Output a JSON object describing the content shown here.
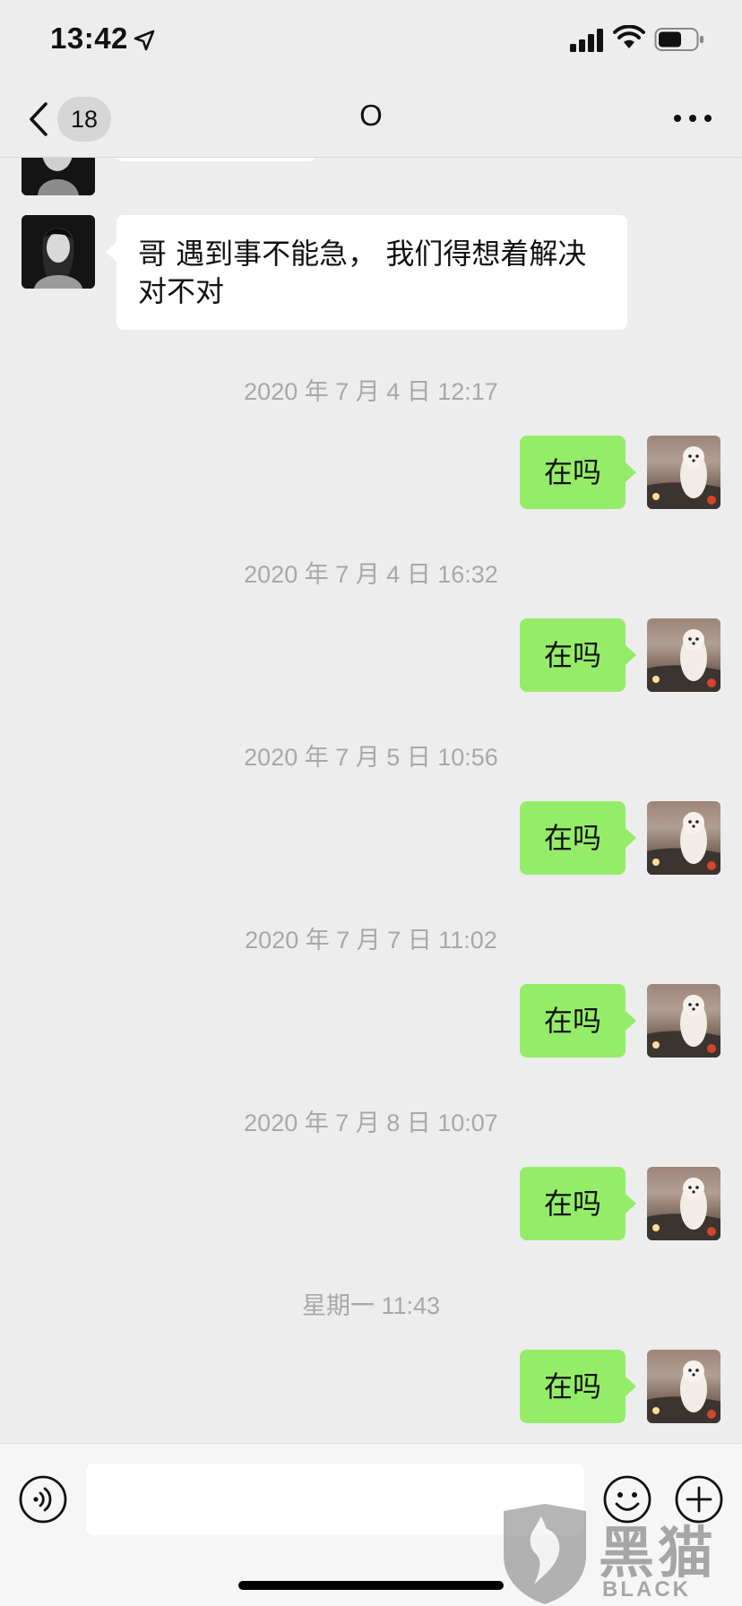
{
  "status_bar": {
    "time": "13:42"
  },
  "nav": {
    "unread_count": "18",
    "title": "O"
  },
  "messages": [
    {
      "type": "in",
      "text": "哥   遇到事不能急， 我们得想着解决对不对"
    },
    {
      "type": "time",
      "text": "2020 年 7 月 4 日 12:17"
    },
    {
      "type": "out",
      "text": "在吗"
    },
    {
      "type": "time",
      "text": "2020 年 7 月 4 日 16:32"
    },
    {
      "type": "out",
      "text": "在吗"
    },
    {
      "type": "time",
      "text": "2020 年 7 月 5 日 10:56"
    },
    {
      "type": "out",
      "text": "在吗"
    },
    {
      "type": "time",
      "text": "2020 年 7 月 7 日 11:02"
    },
    {
      "type": "out",
      "text": "在吗"
    },
    {
      "type": "time",
      "text": "2020 年 7 月 8 日 10:07"
    },
    {
      "type": "out",
      "text": "在吗"
    },
    {
      "type": "time",
      "text": "星期一 11:43"
    },
    {
      "type": "out",
      "text": "在吗"
    }
  ],
  "watermark": {
    "cn": "黑猫",
    "en": "BLACK CAT"
  },
  "icons": {
    "back": "chevron-left-icon",
    "more": "more-dots-icon",
    "voice": "voice-icon",
    "emoji": "emoji-icon",
    "plus": "plus-icon",
    "location": "location-arrow-icon",
    "signal": "signal-icon",
    "wifi": "wifi-icon",
    "battery": "battery-icon"
  },
  "colors": {
    "background": "#ededed",
    "outgoing_bubble": "#95ec69",
    "incoming_bubble": "#ffffff",
    "timestamp_text": "#a8a8a8"
  }
}
